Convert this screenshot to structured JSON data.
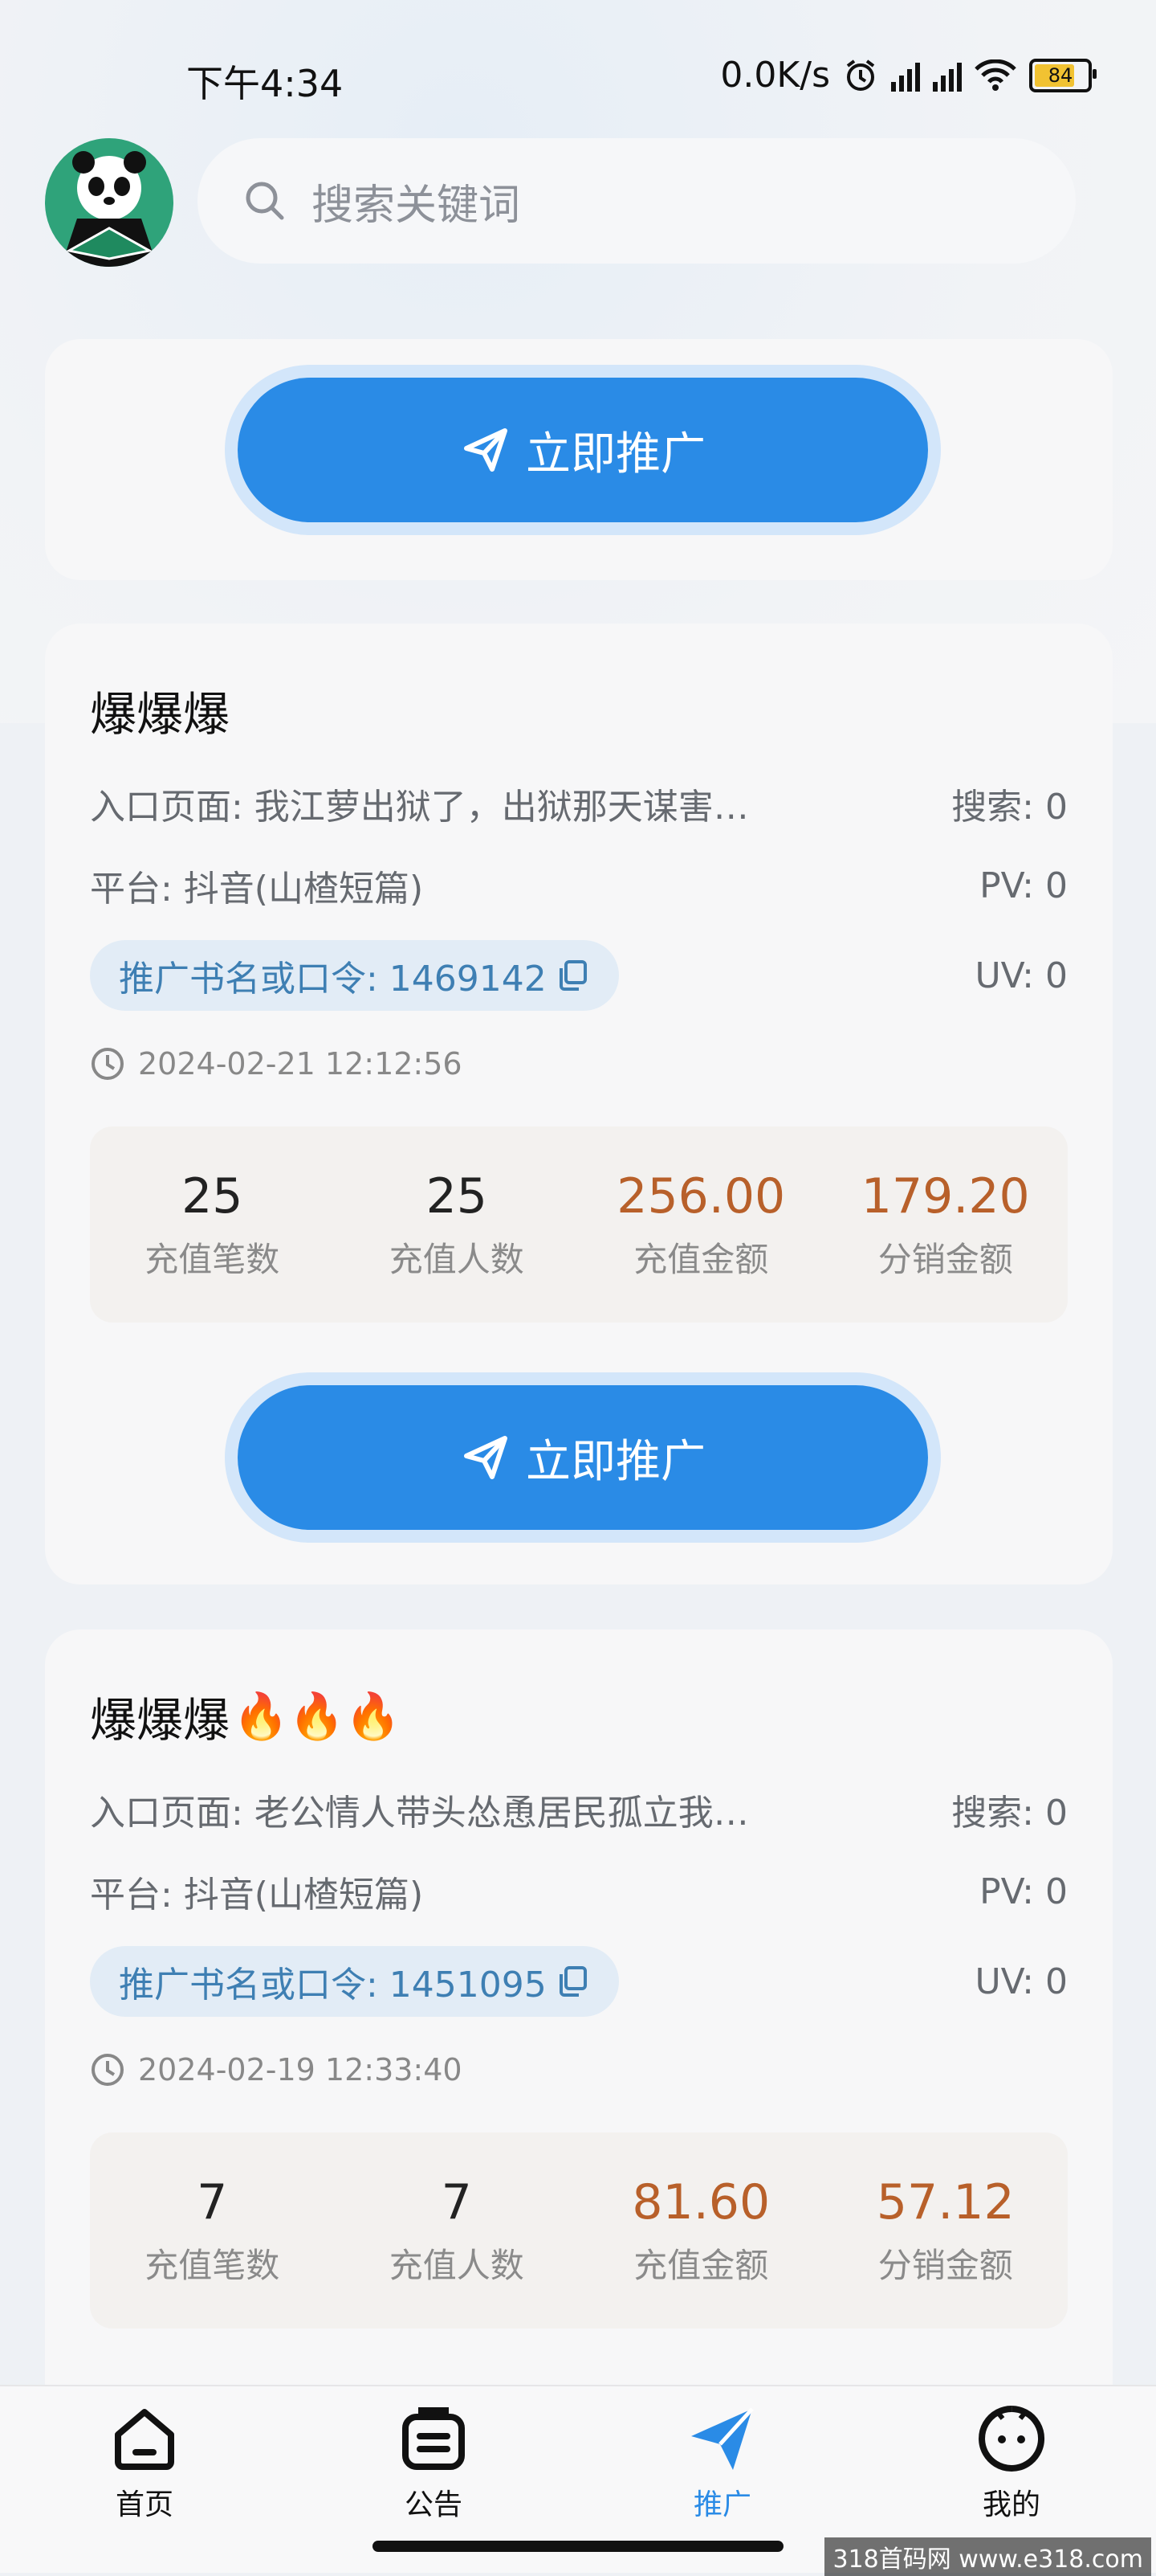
{
  "status_bar": {
    "time": "下午4:34",
    "net_speed": "0.0K/s",
    "battery": "84"
  },
  "search": {
    "placeholder": "搜索关键词"
  },
  "promote_label": "立即推广",
  "cards": [
    {
      "title": "爆爆爆",
      "entry": "入口页面: 我江萝出狱了，出狱那天谋害…",
      "search_count": "搜索: 0",
      "platform": "平台: 抖音(山楂短篇)",
      "pv": "PV: 0",
      "code": "推广书名或口令: 1469142",
      "uv": "UV: 0",
      "timestamp": "2024-02-21 12:12:56",
      "stats": [
        {
          "value": "25",
          "label": "充值笔数"
        },
        {
          "value": "25",
          "label": "充值人数"
        },
        {
          "value": "256.00",
          "label": "充值金额"
        },
        {
          "value": "179.20",
          "label": "分销金额"
        }
      ]
    },
    {
      "title": "爆爆爆",
      "fire": "🔥🔥🔥",
      "entry": "入口页面: 老公情人带头怂恿居民孤立我…",
      "search_count": "搜索: 0",
      "platform": "平台: 抖音(山楂短篇)",
      "pv": "PV: 0",
      "code": "推广书名或口令: 1451095",
      "uv": "UV: 0",
      "timestamp": "2024-02-19 12:33:40",
      "stats": [
        {
          "value": "7",
          "label": "充值笔数"
        },
        {
          "value": "7",
          "label": "充值人数"
        },
        {
          "value": "81.60",
          "label": "充值金额"
        },
        {
          "value": "57.12",
          "label": "分销金额"
        }
      ]
    }
  ],
  "nav": [
    {
      "label": "首页",
      "icon": "home-icon"
    },
    {
      "label": "公告",
      "icon": "notice-icon"
    },
    {
      "label": "推广",
      "icon": "send-icon"
    },
    {
      "label": "我的",
      "icon": "profile-icon"
    }
  ],
  "active_nav": "推广",
  "watermark": "318首码网 www.e318.com",
  "colors": {
    "accent": "#2a8be6",
    "amount": "#b8602a"
  }
}
